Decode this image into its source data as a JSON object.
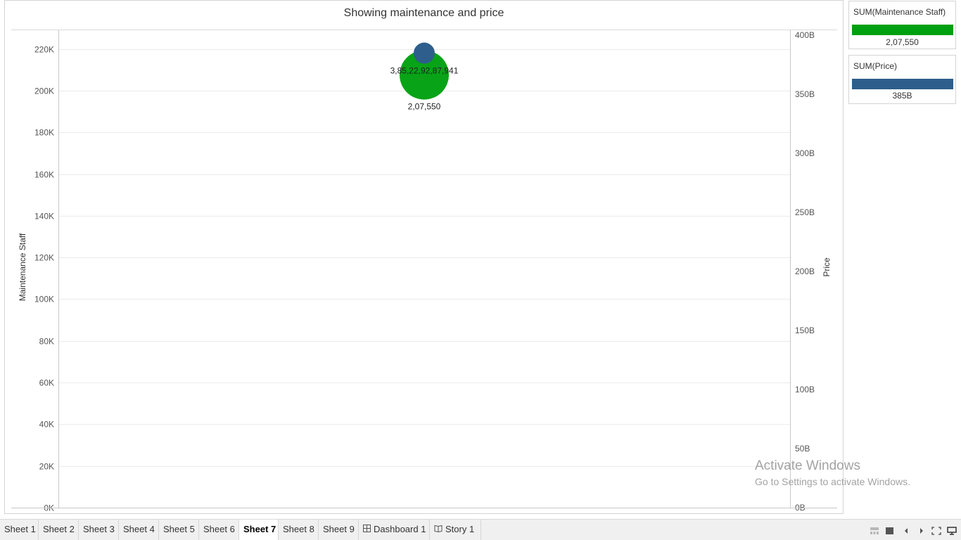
{
  "chart_data": {
    "type": "scatter",
    "title": "Showing maintenance  and price",
    "left_axis": {
      "label": "Maintenance Staff",
      "ylim": [
        0,
        229000
      ],
      "ticks": [
        0,
        20000,
        40000,
        60000,
        80000,
        100000,
        120000,
        140000,
        160000,
        180000,
        200000,
        220000
      ],
      "tick_labels": [
        "0K",
        "20K",
        "40K",
        "60K",
        "80K",
        "100K",
        "120K",
        "140K",
        "160K",
        "180K",
        "200K",
        "220K"
      ]
    },
    "right_axis": {
      "label": "Price",
      "ylim": [
        0,
        404000000000
      ],
      "ticks": [
        0,
        50000000000,
        100000000000,
        150000000000,
        200000000000,
        250000000000,
        300000000000,
        350000000000,
        400000000000
      ],
      "tick_labels": [
        "0B",
        "50B",
        "100B",
        "150B",
        "200B",
        "250B",
        "300B",
        "350B",
        "400B"
      ]
    },
    "gridlines": true,
    "series": [
      {
        "name": "SUM(Maintenance Staff)",
        "axis": "left",
        "value": 207550,
        "label": "2,07,550",
        "color": "#00a010"
      },
      {
        "name": "SUM(Price)",
        "axis": "right",
        "value": 385229287941,
        "label": "3,85,22,92,87,941",
        "color": "#2e5e8b"
      }
    ]
  },
  "legends": [
    {
      "title": "SUM(Maintenance Staff)",
      "value": "2,07,550",
      "color": "#00a010"
    },
    {
      "title": "SUM(Price)",
      "value": "385B",
      "color": "#2e5e8b"
    }
  ],
  "watermark": {
    "title": "Activate Windows",
    "subtitle": "Go to Settings to activate Windows."
  },
  "tabs": [
    {
      "label": "Sheet 1",
      "active": false,
      "icon": ""
    },
    {
      "label": "Sheet 2",
      "active": false,
      "icon": ""
    },
    {
      "label": "Sheet 3",
      "active": false,
      "icon": ""
    },
    {
      "label": "Sheet 4",
      "active": false,
      "icon": ""
    },
    {
      "label": "Sheet 5",
      "active": false,
      "icon": ""
    },
    {
      "label": "Sheet 6",
      "active": false,
      "icon": ""
    },
    {
      "label": "Sheet 7",
      "active": true,
      "icon": ""
    },
    {
      "label": "Sheet 8",
      "active": false,
      "icon": ""
    },
    {
      "label": "Sheet 9",
      "active": false,
      "icon": ""
    },
    {
      "label": "Dashboard 1",
      "active": false,
      "icon": "dashboard-icon"
    },
    {
      "label": "Story 1",
      "active": false,
      "icon": "story-icon"
    }
  ],
  "controls": [
    "filmstrip-icon",
    "tabs-icon",
    "prev-sheet-icon",
    "next-sheet-icon",
    "fullscreen-icon",
    "presentation-icon"
  ]
}
